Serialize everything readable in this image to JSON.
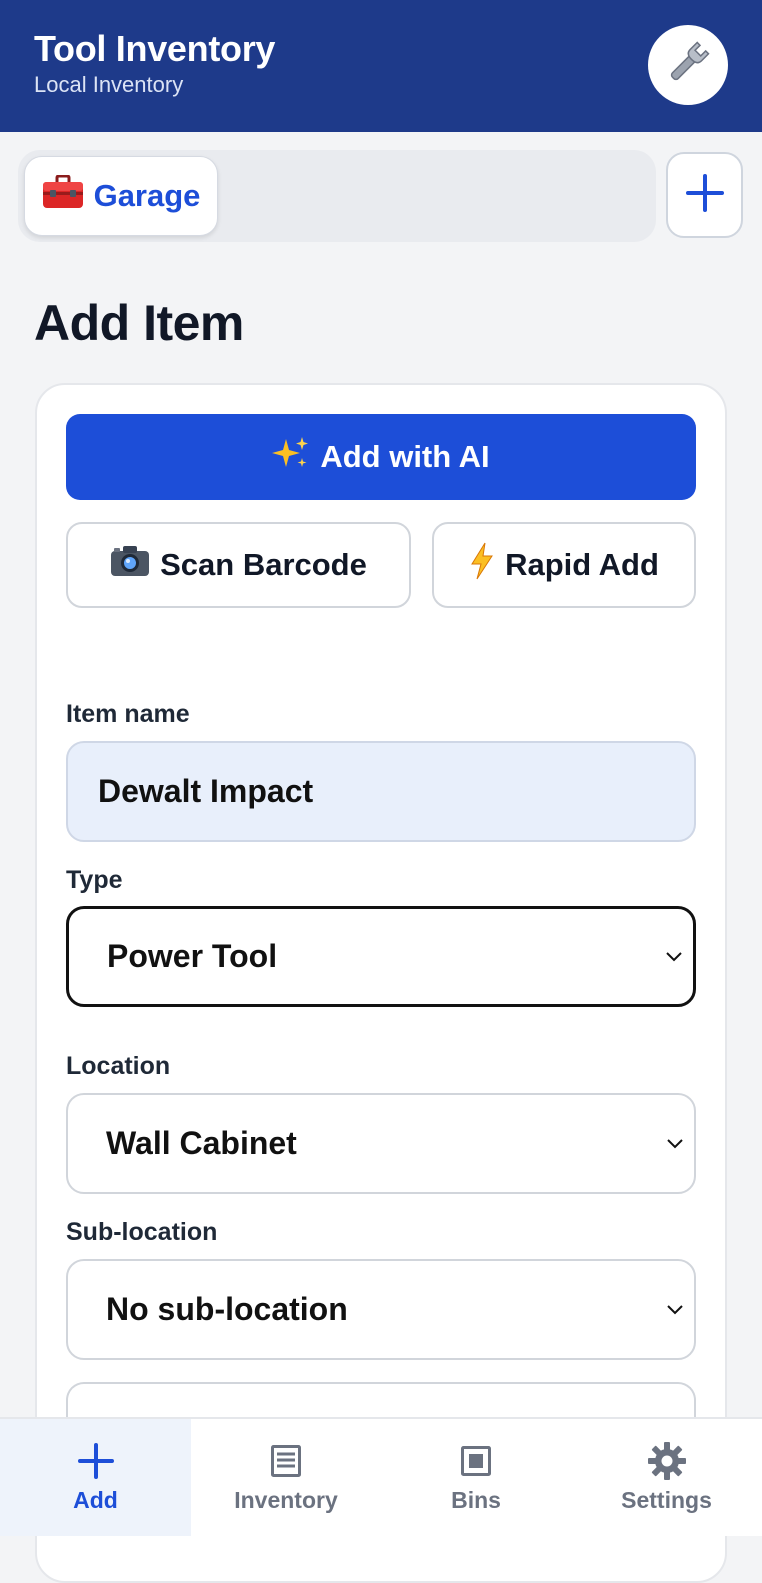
{
  "header": {
    "title": "Tool Inventory",
    "subtitle": "Local Inventory",
    "avatar_icon": "wrench-icon"
  },
  "workspaces": {
    "items": [
      {
        "icon": "toolbox-icon",
        "label": "Garage"
      }
    ],
    "add_icon": "plus-icon"
  },
  "page": {
    "title": "Add Item"
  },
  "actions": {
    "ai_label": "Add with AI",
    "ai_icon": "sparkles-icon",
    "scan_label": "Scan Barcode",
    "scan_icon": "camera-icon",
    "rapid_label": "Rapid Add",
    "rapid_icon": "lightning-icon"
  },
  "form": {
    "name_label": "Item name",
    "name_value": "Dewalt Impact",
    "type_label": "Type",
    "type_value": "Power Tool",
    "location_label": "Location",
    "location_value": "Wall Cabinet",
    "sublocation_label": "Sub-location",
    "sublocation_value": "No sub-location"
  },
  "nav": [
    {
      "label": "Add",
      "icon": "plus-icon",
      "active": true
    },
    {
      "label": "Inventory",
      "icon": "list-icon",
      "active": false
    },
    {
      "label": "Bins",
      "icon": "bin-icon",
      "active": false
    },
    {
      "label": "Settings",
      "icon": "gear-icon",
      "active": false
    }
  ],
  "colors": {
    "header": "#1e3a8a",
    "accent": "#1d4ed8",
    "background": "#f3f4f6"
  }
}
